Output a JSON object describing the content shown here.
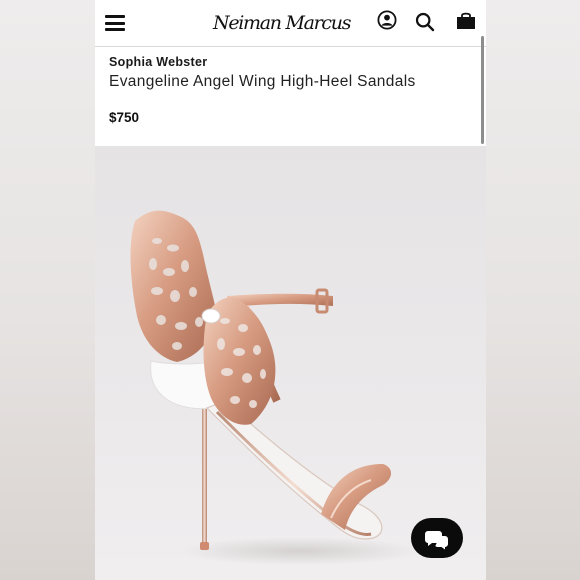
{
  "header": {
    "logo_text": "Neiman Marcus",
    "icons": [
      "menu-icon",
      "account-icon",
      "search-icon",
      "shopping-bag-icon"
    ]
  },
  "product": {
    "brand": "Sophia Webster",
    "name": "Evangeline Angel Wing High-Heel Sandals",
    "price": "$750"
  },
  "chat": {
    "icon": "chat-bubbles-icon"
  },
  "colors": {
    "text": "#1a1a1a",
    "rose_gold": "#d9a48c",
    "photo_background": "#e9e7e8",
    "chat_button": "#0b0b0b"
  }
}
